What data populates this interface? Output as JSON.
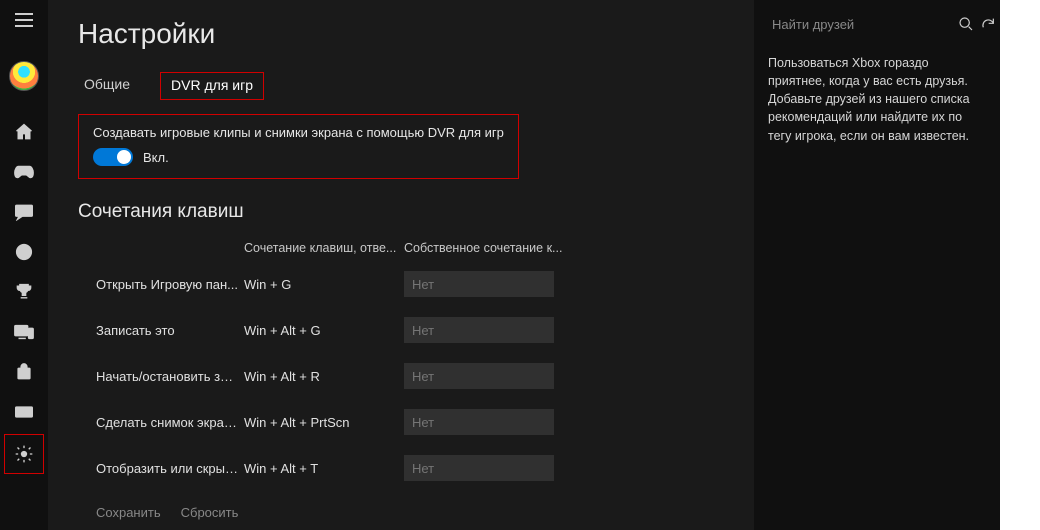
{
  "sidebar": {
    "items": [
      {
        "name": "menu-icon"
      },
      {
        "name": "avatar"
      },
      {
        "name": "home-icon"
      },
      {
        "name": "controller-icon"
      },
      {
        "name": "chat-icon"
      },
      {
        "name": "globe-icon"
      },
      {
        "name": "trophy-icon"
      },
      {
        "name": "devices-icon"
      },
      {
        "name": "store-icon"
      },
      {
        "name": "connect-icon"
      },
      {
        "name": "settings-icon"
      }
    ]
  },
  "page": {
    "title": "Настройки"
  },
  "tabs": [
    {
      "label": "Общие",
      "active": false
    },
    {
      "label": "DVR для игр",
      "active": true
    }
  ],
  "toggle": {
    "label": "Создавать игровые клипы и снимки экрана с помощью DVR для игр",
    "state": "Вкл.",
    "on": true
  },
  "shortcuts": {
    "section_title": "Сочетания клавиш",
    "headers": {
      "default": "Сочетание клавиш, отве...",
      "custom": "Собственное сочетание к..."
    },
    "rows": [
      {
        "name": "Открыть Игровую пан...",
        "default": "Win + G",
        "custom_placeholder": "Нет"
      },
      {
        "name": "Записать это",
        "default": "Win + Alt + G",
        "custom_placeholder": "Нет"
      },
      {
        "name": "Начать/остановить зап...",
        "default": "Win + Alt + R",
        "custom_placeholder": "Нет"
      },
      {
        "name": "Сделать снимок экрана",
        "default": "Win + Alt + PrtScn",
        "custom_placeholder": "Нет"
      },
      {
        "name": "Отобразить или скрыт...",
        "default": "Win + Alt + T",
        "custom_placeholder": "Нет"
      }
    ]
  },
  "footer": {
    "save": "Сохранить",
    "reset": "Сбросить"
  },
  "right_panel": {
    "search_placeholder": "Найти друзей",
    "friends_text": "Пользоваться Xbox гораздо приятнее, когда у вас есть друзья. Добавьте друзей из нашего списка рекомендаций или найдите их по тегу игрока, если он вам известен."
  }
}
